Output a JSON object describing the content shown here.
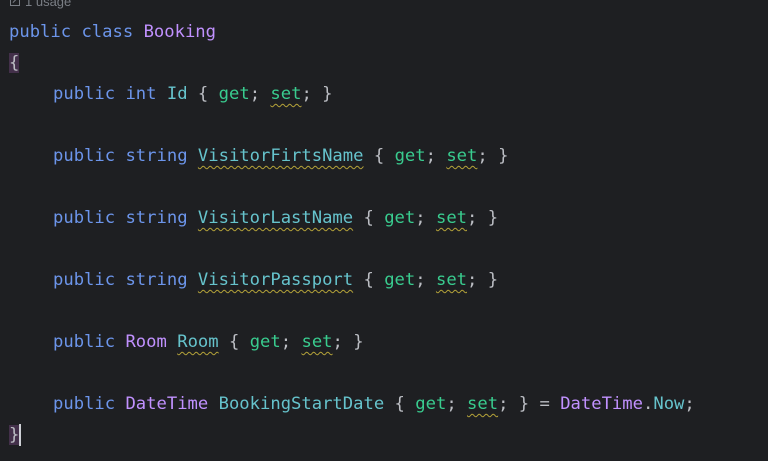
{
  "usage_hint": "1 usage",
  "code": {
    "l_class": {
      "kw1": "public",
      "kw2": "class",
      "name": "Booking"
    },
    "open_brace": "{",
    "close_brace": "}",
    "l_id": {
      "kw": "public",
      "type": "int",
      "name": "Id",
      "o": "{",
      "get": "get",
      "semi1": ";",
      "set": "set",
      "end": "; }"
    },
    "l_first": {
      "kw": "public",
      "type": "string",
      "name": "VisitorFirtsName",
      "o": "{",
      "get": "get",
      "semi1": ";",
      "set": "set",
      "end": "; }"
    },
    "l_last": {
      "kw": "public",
      "type": "string",
      "name": "VisitorLastName",
      "o": "{",
      "get": "get",
      "semi1": ";",
      "set": "set",
      "end": "; }"
    },
    "l_pass": {
      "kw": "public",
      "type": "string",
      "name": "VisitorPassport",
      "o": "{",
      "get": "get",
      "semi1": ";",
      "set": "set",
      "end": "; }"
    },
    "l_room": {
      "kw": "public",
      "type": "Room",
      "name": "Room",
      "o": "{",
      "get": "get",
      "semi1": ";",
      "set": "set",
      "end": "; }"
    },
    "l_date": {
      "kw": "public",
      "type": "DateTime",
      "name": "BookingStartDate",
      "o": "{",
      "get": "get",
      "semi1": ";",
      "set": "set",
      "end": "; } =",
      "init_type": "DateTime",
      "dot": ".",
      "init_member": "Now",
      "final": ";"
    }
  },
  "colors": {
    "background": "#1e1f22",
    "keyword": "#6c95eb",
    "class_name": "#c191ff",
    "property": "#66c3cc",
    "accessor": "#39cc8f",
    "typo_underline": "#b5a339"
  }
}
